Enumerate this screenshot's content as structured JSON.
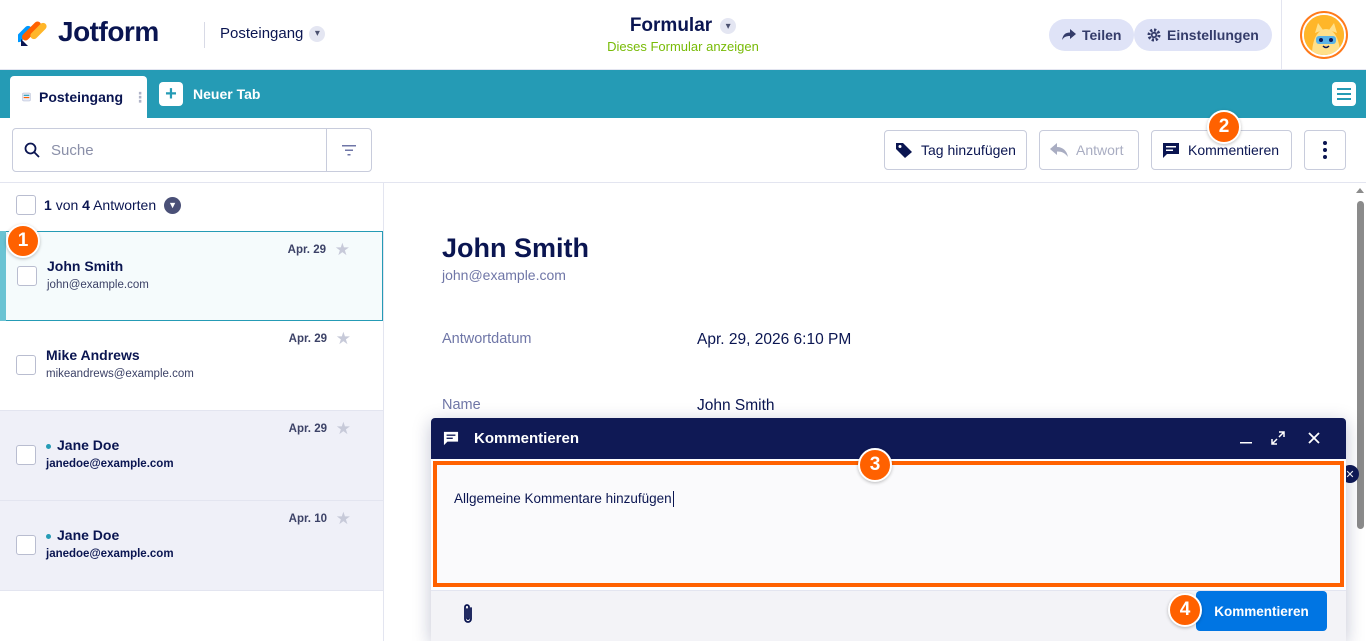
{
  "header": {
    "brand": "Jotform",
    "inbox_label": "Posteingang",
    "form_title": "Formular",
    "form_subtitle": "Dieses Formular anzeigen",
    "share_label": "Teilen",
    "settings_label": "Einstellungen"
  },
  "tabs": {
    "active_label": "Posteingang",
    "new_tab_label": "Neuer Tab"
  },
  "toolbar": {
    "search_placeholder": "Suche",
    "tag_label": "Tag hinzufügen",
    "reply_label": "Antwort",
    "comment_label": "Kommentieren"
  },
  "list": {
    "count_current": "1",
    "count_of": "von",
    "count_total": "4",
    "count_label": "Antworten",
    "items": [
      {
        "name": "John Smith",
        "email": "john@example.com",
        "date": "Apr. 29",
        "selected": true,
        "unread": false
      },
      {
        "name": "Mike Andrews",
        "email": "mikeandrews@example.com",
        "date": "Apr. 29",
        "selected": false,
        "unread": false
      },
      {
        "name": "Jane Doe",
        "email": "janedoe@example.com",
        "date": "Apr. 29",
        "selected": false,
        "unread": true
      },
      {
        "name": "Jane Doe",
        "email": "janedoe@example.com",
        "date": "Apr. 10",
        "selected": false,
        "unread": true
      }
    ]
  },
  "detail": {
    "name": "John Smith",
    "email": "john@example.com",
    "fields": [
      {
        "label": "Antwortdatum",
        "value": "Apr. 29, 2026 6:10 PM"
      },
      {
        "label": "Name",
        "value": "John Smith"
      }
    ]
  },
  "comment_popup": {
    "title": "Kommentieren",
    "text": "Allgemeine Kommentare hinzufügen",
    "submit_label": "Kommentieren"
  },
  "badges": [
    "1",
    "2",
    "3",
    "4"
  ],
  "colors": {
    "accent": "#ff6100",
    "tabbar": "#259bb5",
    "navy": "#0a1551",
    "primary_button": "#0075e3",
    "subtitle_green": "#78bb07"
  }
}
